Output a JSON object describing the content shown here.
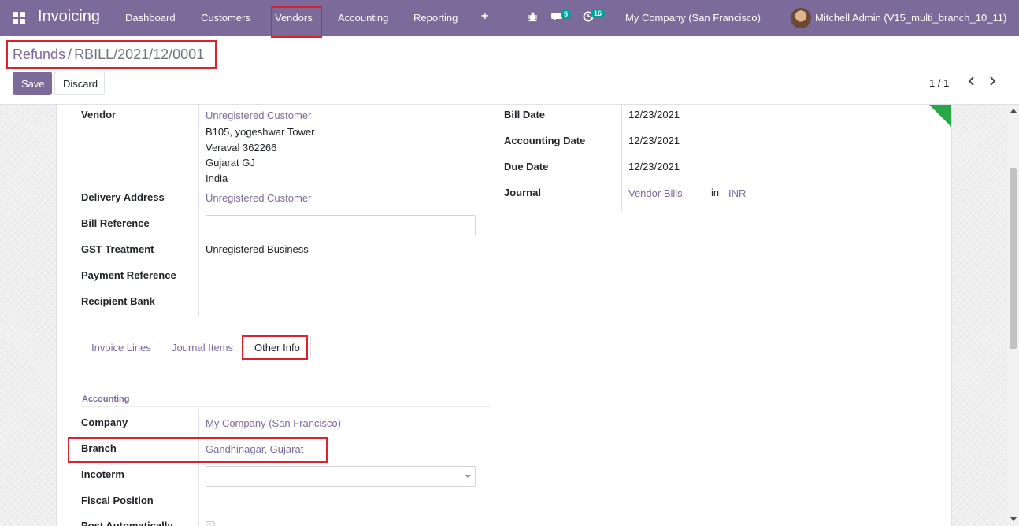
{
  "navbar": {
    "app_name": "Invoicing",
    "menu": [
      "Dashboard",
      "Customers",
      "Vendors",
      "Accounting",
      "Reporting"
    ],
    "plus_label": "+",
    "chat_badge": "5",
    "activity_badge": "16",
    "company": "My Company (San Francisco)",
    "user": "Mitchell Admin (V15_multi_branch_10_11)"
  },
  "breadcrumb": {
    "parent": "Refunds",
    "separator": "/",
    "current": "RBILL/2021/12/0001"
  },
  "buttons": {
    "save": "Save",
    "discard": "Discard"
  },
  "pager": {
    "value": "1 / 1"
  },
  "form_left": {
    "vendor_label": "Vendor",
    "vendor_name": "Unregistered Customer",
    "vendor_address": [
      "B105, yogeshwar Tower",
      "Veraval 362266",
      "Gujarat GJ",
      "India"
    ],
    "delivery_address_label": "Delivery Address",
    "delivery_address_value": "Unregistered Customer",
    "bill_reference_label": "Bill Reference",
    "bill_reference_value": "",
    "gst_treatment_label": "GST Treatment",
    "gst_treatment_value": "Unregistered Business",
    "payment_reference_label": "Payment Reference",
    "recipient_bank_label": "Recipient Bank"
  },
  "form_right": {
    "bill_date_label": "Bill Date",
    "bill_date_value": "12/23/2021",
    "accounting_date_label": "Accounting Date",
    "accounting_date_value": "12/23/2021",
    "due_date_label": "Due Date",
    "due_date_value": "12/23/2021",
    "journal_label": "Journal",
    "journal_value": "Vendor Bills",
    "journal_in": "in",
    "journal_currency": "INR"
  },
  "tabs": [
    "Invoice Lines",
    "Journal Items",
    "Other Info"
  ],
  "active_tab": "Other Info",
  "other_info": {
    "section_title": "Accounting",
    "company_label": "Company",
    "company_value": "My Company (San Francisco)",
    "branch_label": "Branch",
    "branch_value": "Gandhinagar, Gujarat",
    "incoterm_label": "Incoterm",
    "incoterm_value": "",
    "fiscal_position_label": "Fiscal Position",
    "post_automatically_label": "Post Automatically"
  },
  "colors": {
    "brand": "#7c6a9a",
    "highlight": "#d9232e",
    "ribbon": "#28a745",
    "badge": "#00a09d"
  }
}
